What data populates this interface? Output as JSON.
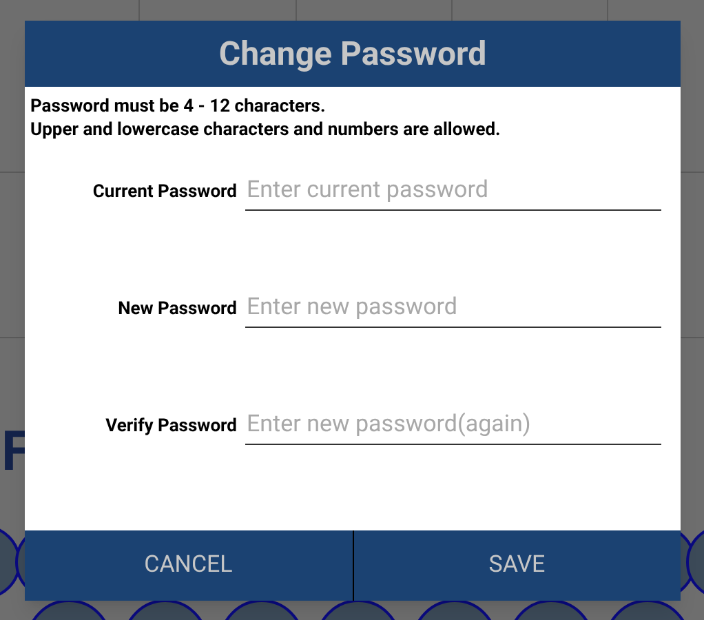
{
  "background": {
    "partial_text": "F"
  },
  "dialog": {
    "title": "Change Password",
    "rules": [
      "Password must be 4 - 12 characters.",
      "Upper and lowercase characters and numbers are allowed."
    ],
    "fields": [
      {
        "label": "Current Password",
        "placeholder": "Enter current password"
      },
      {
        "label": "New Password",
        "placeholder": "Enter new password"
      },
      {
        "label": "Verify Password",
        "placeholder": "Enter new password(again)"
      }
    ],
    "buttons": [
      "CANCEL",
      "SAVE"
    ]
  }
}
